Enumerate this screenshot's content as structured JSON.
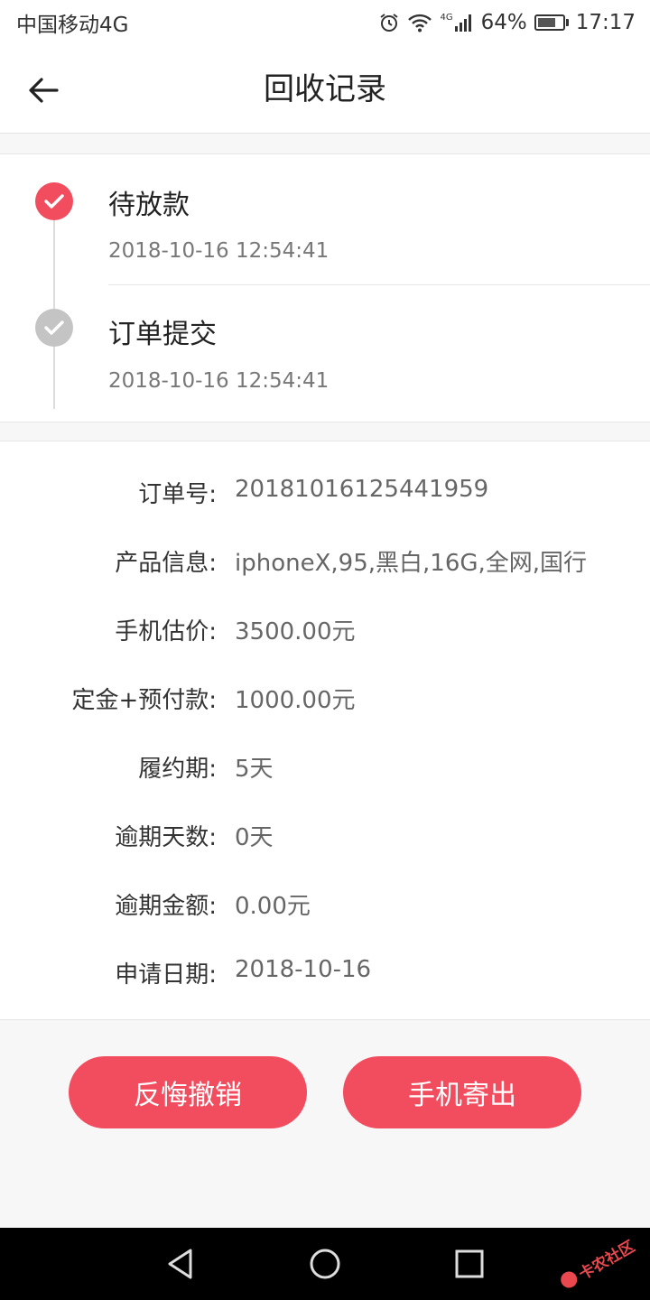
{
  "status_bar": {
    "carrier": "中国移动4G",
    "network": "4G",
    "battery_percent": "64%",
    "time": "17:17"
  },
  "header": {
    "title": "回收记录",
    "back_icon": "arrow-left-icon"
  },
  "timeline": [
    {
      "title": "待放款",
      "time": "2018-10-16 12:54:41",
      "state": "active"
    },
    {
      "title": "订单提交",
      "time": "2018-10-16 12:54:41",
      "state": "done"
    }
  ],
  "details": [
    {
      "label": "订单号:",
      "value": "20181016125441959"
    },
    {
      "label": "产品信息:",
      "value": "iphoneX,95,黑白,16G,全网,国行"
    },
    {
      "label": "手机估价:",
      "value": "3500.00元"
    },
    {
      "label": "定金+预付款:",
      "value": "1000.00元"
    },
    {
      "label": "履约期:",
      "value": "5天"
    },
    {
      "label": "逾期天数:",
      "value": "0天"
    },
    {
      "label": "逾期金额:",
      "value": "0.00元"
    },
    {
      "label": "申请日期:",
      "value": "2018-10-16"
    }
  ],
  "actions": {
    "cancel_label": "反悔撤销",
    "ship_label": "手机寄出"
  },
  "watermark": {
    "text": "卡农社区"
  },
  "colors": {
    "accent": "#f24c5f",
    "inactive_dot": "#c4c4c4",
    "page_background": "#f7f7f7"
  }
}
